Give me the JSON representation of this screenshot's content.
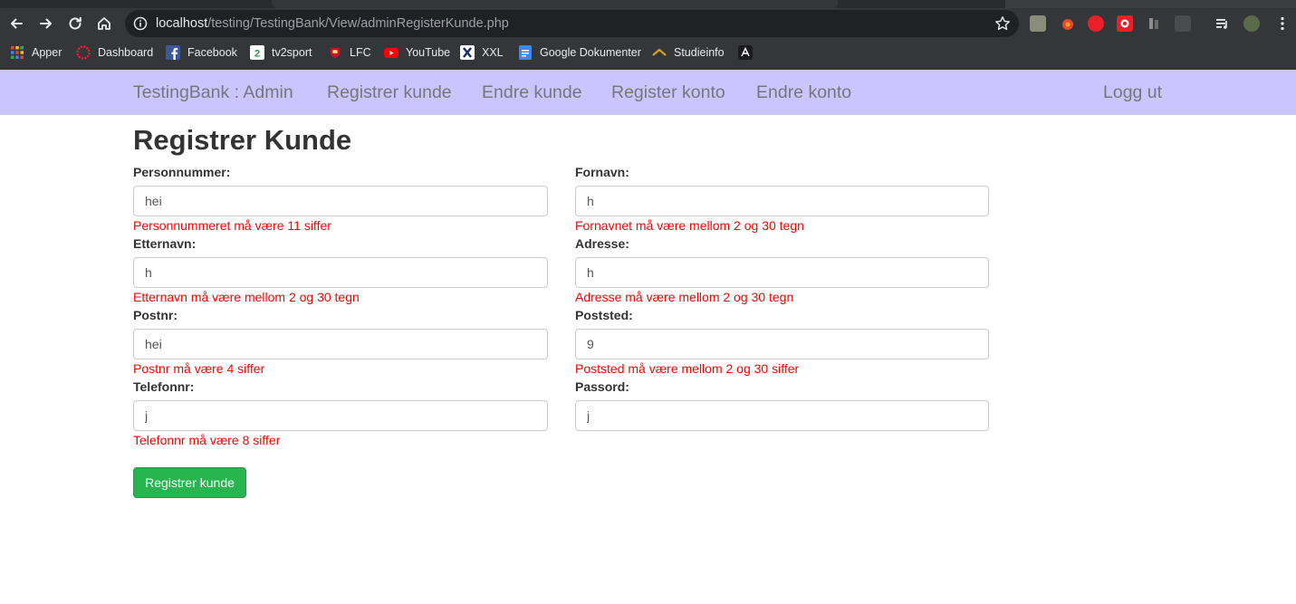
{
  "browser": {
    "url_host": "localhost",
    "url_path": "/testing/TestingBank/View/adminRegisterKunde.php",
    "bookmarks": [
      {
        "label": "Apper",
        "icon": "apps-grid-icon"
      },
      {
        "label": "Dashboard",
        "icon": "dashboard-ring-icon"
      },
      {
        "label": "Facebook",
        "icon": "facebook-icon"
      },
      {
        "label": "tv2sport",
        "icon": "tv2-icon"
      },
      {
        "label": "LFC",
        "icon": "lfc-crest-icon"
      },
      {
        "label": "YouTube",
        "icon": "youtube-icon"
      },
      {
        "label": "XXL",
        "icon": "xxl-icon"
      },
      {
        "label": "Google Dokumenter",
        "icon": "google-docs-icon"
      },
      {
        "label": "Studieinfo",
        "icon": "studieinfo-icon"
      },
      {
        "label": "",
        "icon": "angular-icon"
      }
    ],
    "colors": {
      "chrome": "#35363a",
      "omnibox": "#202124"
    }
  },
  "navbar": {
    "brand": "TestingBank : Admin",
    "links": [
      "Registrer kunde",
      "Endre kunde",
      "Register konto",
      "Endre konto"
    ],
    "logout": "Logg ut",
    "background": "#cac5ff"
  },
  "form": {
    "title": "Registrer Kunde",
    "fields": [
      {
        "label": "Personnummer:",
        "value": "hei",
        "error": "Personnummeret må være 11 siffer"
      },
      {
        "label": "Fornavn:",
        "value": "h",
        "error": "Fornavnet må være mellom 2 og 30 tegn"
      },
      {
        "label": "Etternavn:",
        "value": "h",
        "error": "Etternavn må være mellom 2 og 30 tegn"
      },
      {
        "label": "Adresse:",
        "value": "h",
        "error": "Adresse må være mellom 2 og 30 tegn"
      },
      {
        "label": "Postnr:",
        "value": "hei",
        "error": "Postnr må være 4 siffer"
      },
      {
        "label": "Poststed:",
        "value": "9",
        "error": "Poststed må være mellom 2 og 30 siffer"
      },
      {
        "label": "Telefonnr:",
        "value": "j",
        "error": "Telefonnr må være 8 siffer"
      },
      {
        "label": "Passord:",
        "value": "j",
        "error": ""
      }
    ],
    "submit_label": "Registrer kunde",
    "error_color": "#ff0000",
    "submit_color": "#28b550"
  }
}
